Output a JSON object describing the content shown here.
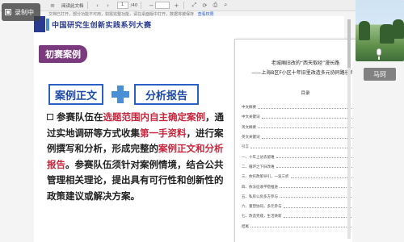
{
  "recording": {
    "label": "录制中",
    "icon": "record-icon"
  },
  "toolbar": {
    "doc_title": "阅读此文档",
    "current_page": "1",
    "total_pages": "/40",
    "zoom": "",
    "notice": "文档已打开，部分功能不可用，如需完整功能，请在桌面版中打开，数据将被保存",
    "notice_link": "查看权限"
  },
  "slide": {
    "header": "中国研究生创新实践系列大赛",
    "tag": "初赛案例",
    "badge_a": "案例正文",
    "badge_b": "分析报告",
    "para": {
      "p1": "参赛队伍在",
      "r1": "选题范围内自主确定案例",
      "p2": "，通过实地调研等方式收集",
      "r2": "第一手资料",
      "p3": "，进行案例撰写和分析，形成完整的",
      "r3": "案例正文和分析报告",
      "p4": "。参赛队伍须针对案例情境，结合公共管理相关理论，提出具有可行性和创新性的政策建议或解决方案。"
    }
  },
  "doc": {
    "title1": "老城厢旧改的“西天取经”漫长路",
    "title2": "——上海B区F小区十年旧里改造多元协同路径探索",
    "toc_heading": "目录",
    "toc": [
      {
        "label": "中文摘要",
        "page": "1"
      },
      {
        "label": "中文关键词",
        "page": "1"
      },
      {
        "label": "英文摘要",
        "page": "1"
      },
      {
        "label": "英文关键词",
        "page": "2"
      },
      {
        "label": "引言",
        "page": "2"
      },
      {
        "label": "一、十年上访去留难",
        "page": "3"
      },
      {
        "label": "二、循环之下旧改难",
        "page": "5"
      },
      {
        "label": "三、依托政策导引，一波三折",
        "page": "8"
      },
      {
        "label": "四、依法征收平稳推进",
        "page": "12"
      },
      {
        "label": "五、私房公房多方参与",
        "page": "16"
      },
      {
        "label": "六、重塑协同，多元参与",
        "page": "19"
      },
      {
        "label": "七、改造完成，生活焕新",
        "page": "22"
      },
      {
        "label": "结尾",
        "page": "24"
      }
    ]
  },
  "participant": {
    "name": "马珂"
  }
}
